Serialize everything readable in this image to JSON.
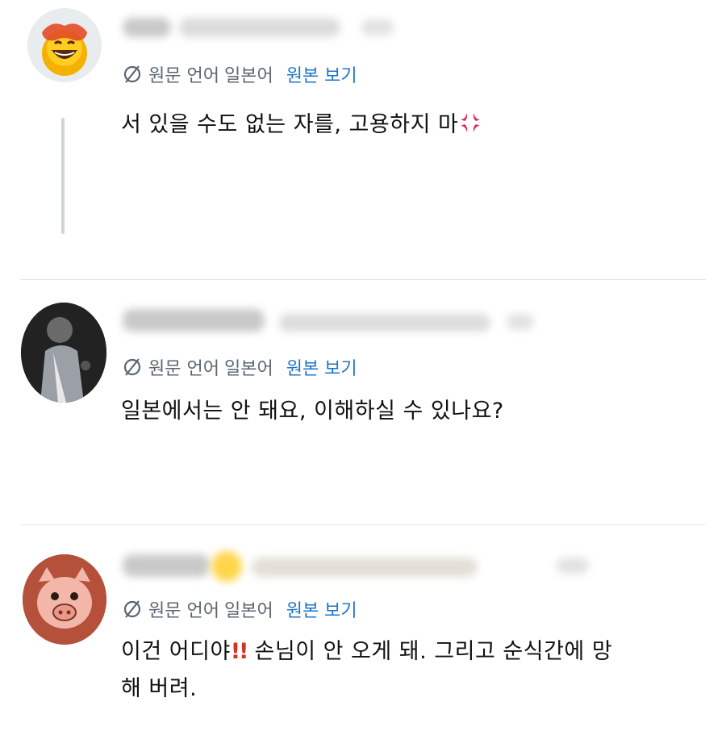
{
  "replies": [
    {
      "translation": {
        "prefix": "원문 언어",
        "language": "일본어",
        "show_original": "원본 보기"
      },
      "body": "서 있을 수도 없는 자를, 고용하지 마",
      "emoji": "anger-symbol-icon"
    },
    {
      "translation": {
        "prefix": "원문 언어",
        "language": "일본어",
        "show_original": "원본 보기"
      },
      "body": "일본에서는 안 돼요, 이해하실 수 있나요?"
    },
    {
      "translation": {
        "prefix": "원문 언어",
        "language": "일본어",
        "show_original": "원본 보기"
      },
      "body_part1": "이건 어디야",
      "emoji": "double-exclamation-icon",
      "emoji_text": "!!",
      "body_part2": " 손님이 안 오게 돼. 그리고 순식간에 망",
      "body_line2": "해 버려."
    }
  ],
  "colors": {
    "link": "#1d76c7",
    "meta": "#5b6670",
    "divider": "#e6e6e6",
    "thread_line": "#cfd4d9",
    "emphasis": "#d93025"
  }
}
